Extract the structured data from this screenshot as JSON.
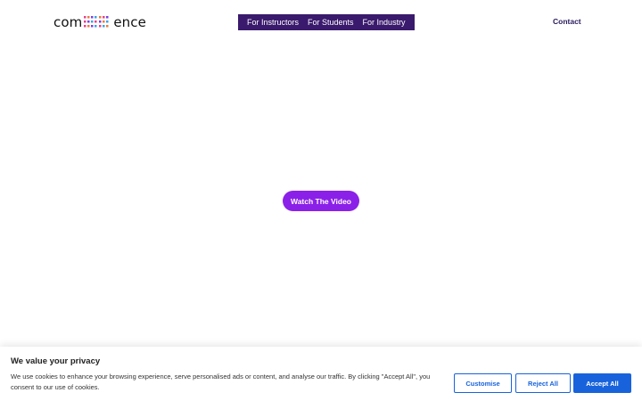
{
  "header": {
    "logo": {
      "text_left": "com",
      "text_right": "ence"
    },
    "nav": [
      {
        "label": "For Instructors"
      },
      {
        "label": "For Students"
      },
      {
        "label": "For Industry"
      }
    ],
    "contact_label": "Contact"
  },
  "hero": {
    "cta_label": "Watch The Video"
  },
  "cookie_banner": {
    "title": "We value your privacy",
    "text": "We use cookies to enhance your browsing experience, serve personalised ads or content, and analyse our traffic. By clicking \"Accept All\", you consent to our use of cookies.",
    "customise_label": "Customise",
    "reject_label": "Reject All",
    "accept_label": "Accept All"
  },
  "colors": {
    "nav_bg": "#3a1a6c",
    "cta": "#8b21e8",
    "cookie_accent": "#1863dc"
  }
}
